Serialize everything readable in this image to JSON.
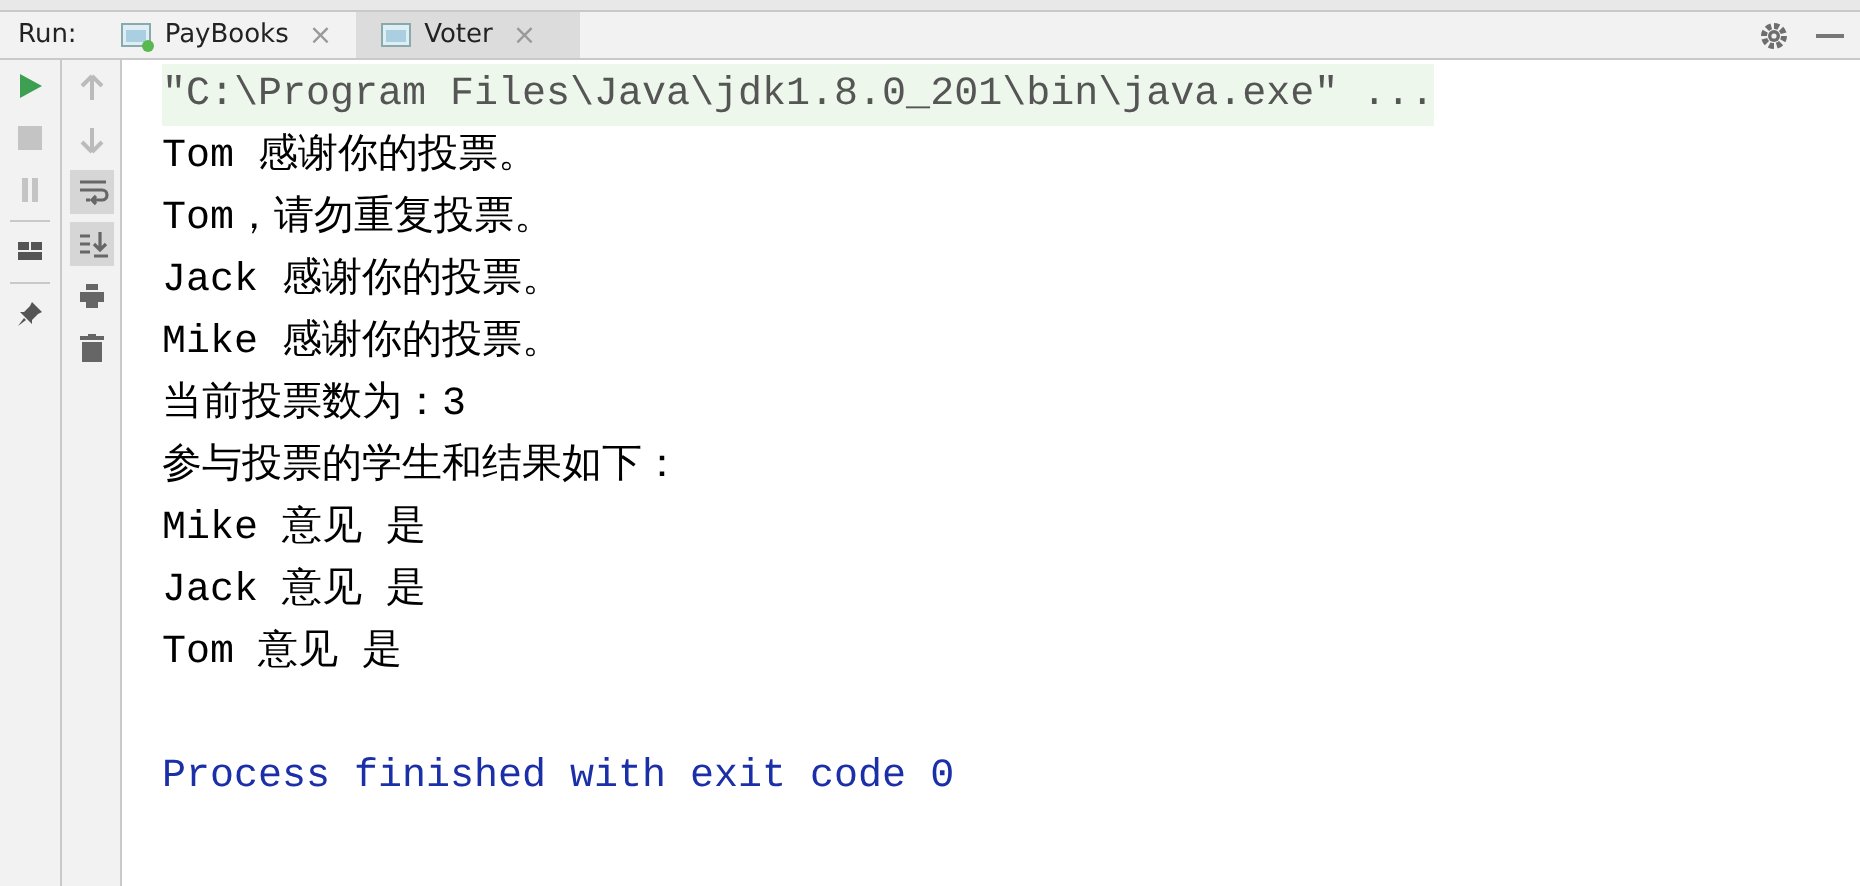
{
  "run_label": "Run:",
  "tabs": [
    {
      "label": "PayBooks",
      "selected": false,
      "running": true,
      "close": "×"
    },
    {
      "label": "Voter",
      "selected": true,
      "running": false,
      "close": "×"
    }
  ],
  "left_toolbar": [
    {
      "kind": "run",
      "disabled": false
    },
    {
      "kind": "stop",
      "disabled": true
    },
    {
      "kind": "pause",
      "disabled": true
    },
    {
      "kind": "sep"
    },
    {
      "kind": "layout",
      "disabled": false
    },
    {
      "kind": "sep"
    },
    {
      "kind": "pin",
      "disabled": false
    }
  ],
  "right_toolbar": [
    {
      "kind": "up",
      "pressed": false
    },
    {
      "kind": "down",
      "pressed": false
    },
    {
      "kind": "wrap",
      "pressed": true
    },
    {
      "kind": "scroll",
      "pressed": true
    },
    {
      "kind": "print",
      "pressed": false
    },
    {
      "kind": "trash",
      "pressed": false
    }
  ],
  "console": [
    {
      "kind": "command",
      "text": "\"C:\\Program Files\\Java\\jdk1.8.0_201\\bin\\java.exe\" ..."
    },
    {
      "kind": "out",
      "text": "Tom 感谢你的投票。"
    },
    {
      "kind": "out",
      "text": "Tom，请勿重复投票。"
    },
    {
      "kind": "out",
      "text": "Jack 感谢你的投票。"
    },
    {
      "kind": "out",
      "text": "Mike 感谢你的投票。"
    },
    {
      "kind": "out",
      "text": "当前投票数为：3"
    },
    {
      "kind": "out",
      "text": "参与投票的学生和结果如下："
    },
    {
      "kind": "out",
      "text": "Mike 意见 是"
    },
    {
      "kind": "out",
      "text": "Jack 意见 是"
    },
    {
      "kind": "out",
      "text": "Tom 意见 是"
    },
    {
      "kind": "blank"
    },
    {
      "kind": "system",
      "text": "Process finished with exit code 0"
    }
  ]
}
